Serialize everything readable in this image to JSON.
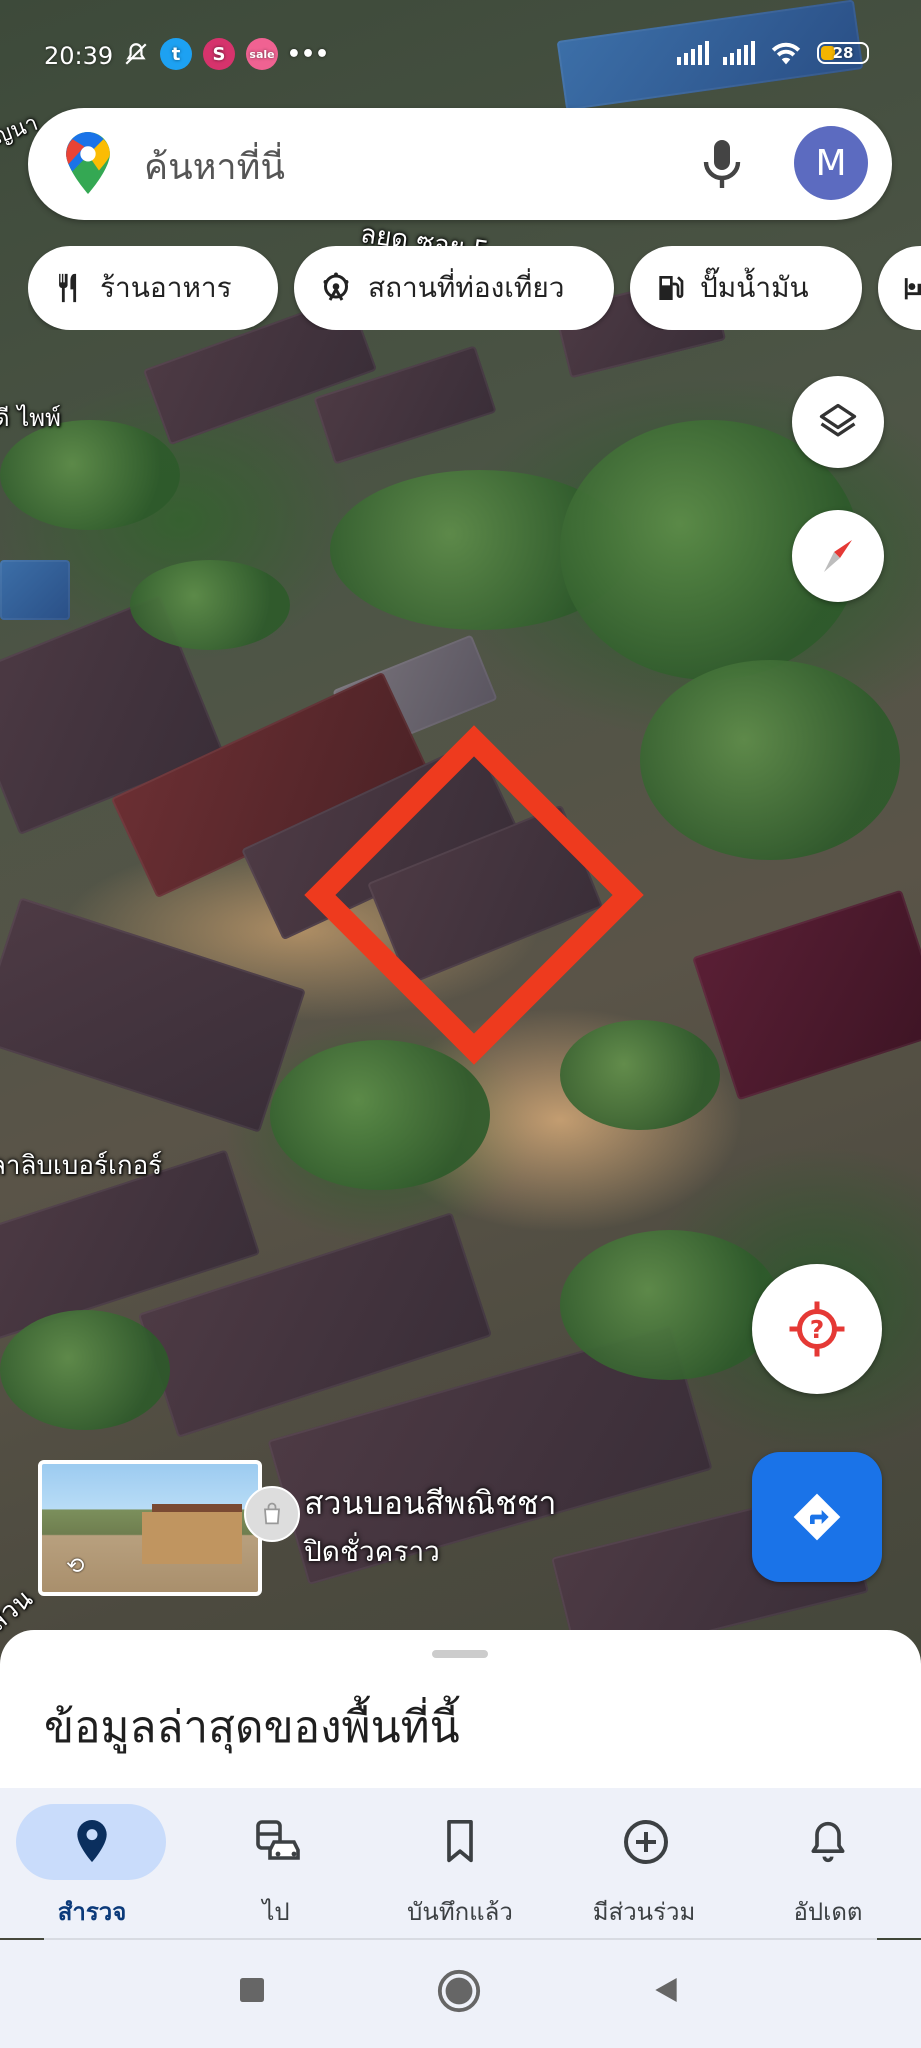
{
  "status_bar": {
    "time": "20:39",
    "battery": "28",
    "notification_icons": [
      "muted-icon",
      "twitter-icon",
      "shopee-s-icon",
      "sale-app-icon",
      "more-dots-icon"
    ]
  },
  "search": {
    "placeholder": "ค้นหาที่นี่",
    "avatar_letter": "M"
  },
  "chips": [
    {
      "label": "ร้านอาหาร",
      "icon": "restaurant-icon"
    },
    {
      "label": "สถานที่ท่องเที่ยว",
      "icon": "attraction-icon"
    },
    {
      "label": "ปั๊มน้ำมัน",
      "icon": "gas-station-icon"
    }
  ],
  "map_labels": {
    "street": "ลยด ซอย 5",
    "left_1": "ญนา",
    "left_2": "ดี ไพพ์",
    "left_3": "ลาลิบเบอร์เกอร์",
    "left_4": "สวน"
  },
  "place": {
    "name": "สวนบอนสีพณิชชา",
    "status": "ปิดชั่วคราว"
  },
  "sheet": {
    "title": "ข้อมูลล่าสุดของพื้นที่นี้"
  },
  "nav": [
    {
      "label": "สำรวจ",
      "icon": "explore-pin-icon",
      "active": true
    },
    {
      "label": "ไป",
      "icon": "commute-icon",
      "active": false
    },
    {
      "label": "บันทึกแล้ว",
      "icon": "bookmark-icon",
      "active": false
    },
    {
      "label": "มีส่วนร่วม",
      "icon": "contribute-icon",
      "active": false
    },
    {
      "label": "อัปเดต",
      "icon": "bell-icon",
      "active": false
    }
  ],
  "colors": {
    "accent": "#1a73e8",
    "marker": "#ee3a1e",
    "nav_active_pill": "#c9dcfb",
    "avatar": "#5c6bc0"
  }
}
